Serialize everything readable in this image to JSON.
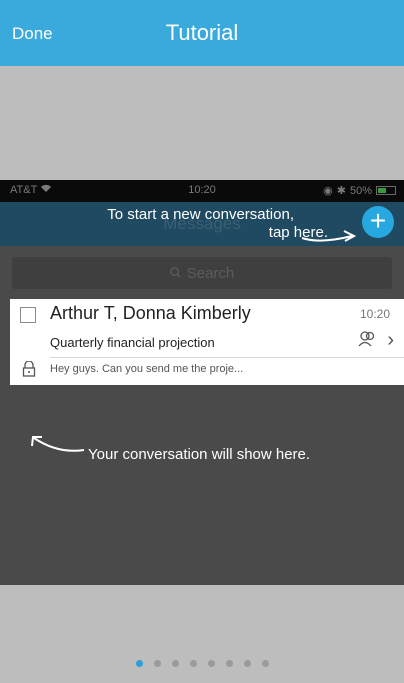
{
  "header": {
    "done_label": "Done",
    "title": "Tutorial",
    "color": "#3aa9dc"
  },
  "status_bar": {
    "carrier": "AT&T",
    "time": "10:20",
    "battery": "50%",
    "battery_level": 0.5
  },
  "messages_screen": {
    "nav_title": "Messages",
    "new_conversation_hint_line1": "To start a new conversation,",
    "new_conversation_hint_line2": "tap here.",
    "plus_icon": "+",
    "search_placeholder": "Search",
    "conversation": {
      "participants": "Arthur T, Donna Kimberly",
      "time": "10:20",
      "subject": "Quarterly financial projection",
      "preview": "Hey guys. Can you send me the proje..."
    },
    "conversation_hint": "Your conversation will show here."
  },
  "pager": {
    "total_pages": 8,
    "current_page": 1,
    "active_color": "#2a9fd8"
  }
}
